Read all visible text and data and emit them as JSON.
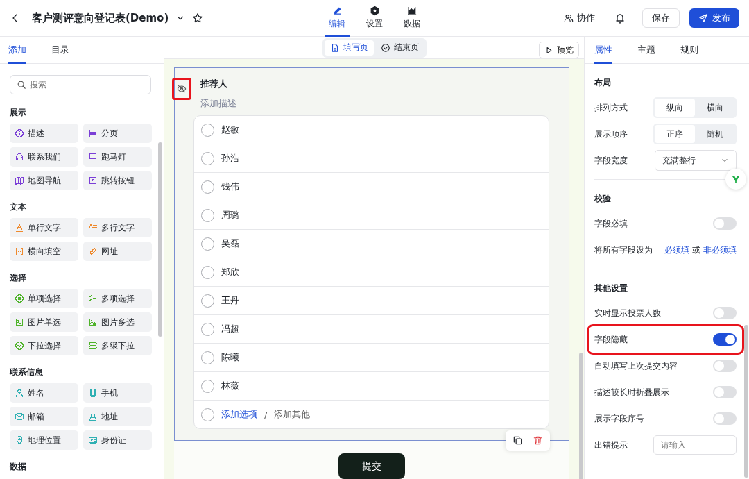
{
  "header": {
    "title": "客户测评意向登记表(Demo)",
    "nav": [
      {
        "label": "编辑",
        "selected": true
      },
      {
        "label": "设置",
        "selected": false
      },
      {
        "label": "数据",
        "selected": false
      }
    ],
    "collab": "协作",
    "save": "保存",
    "publish": "发布"
  },
  "left": {
    "tabs": [
      {
        "label": "添加",
        "selected": true
      },
      {
        "label": "目录",
        "selected": false
      }
    ],
    "search": {
      "placeholder": "搜索"
    },
    "groups": [
      {
        "title": "展示",
        "color": "#7b3fd6",
        "items": [
          "描述",
          "分页",
          "联系我们",
          "跑马灯",
          "地图导航",
          "跳转按钮"
        ]
      },
      {
        "title": "文本",
        "color": "#ef8a2d",
        "items": [
          "单行文字",
          "多行文字",
          "横向填空",
          "网址"
        ]
      },
      {
        "title": "选择",
        "color": "#4fb32a",
        "items": [
          "单项选择",
          "多项选择",
          "图片单选",
          "图片多选",
          "下拉选择",
          "多级下拉"
        ]
      },
      {
        "title": "联系信息",
        "color": "#2fb0b3",
        "items": [
          "姓名",
          "手机",
          "邮箱",
          "地址",
          "地理位置",
          "身份证"
        ]
      },
      {
        "title": "数据"
      }
    ]
  },
  "center": {
    "pages": [
      {
        "label": "填写页",
        "selected": true
      },
      {
        "label": "结束页",
        "selected": false
      }
    ],
    "preview": "预览",
    "question": {
      "title": "推荐人",
      "hidden": true,
      "description": "添加描述",
      "options": [
        {
          "label": "赵敏",
          "checked": false
        },
        {
          "label": "孙浩",
          "checked": false
        },
        {
          "label": "钱伟",
          "checked": false
        },
        {
          "label": "周璐",
          "checked": false
        },
        {
          "label": "吴磊",
          "checked": false
        },
        {
          "label": "郑欣",
          "checked": false
        },
        {
          "label": "王丹",
          "checked": false
        },
        {
          "label": "冯超",
          "checked": false
        },
        {
          "label": "陈曦",
          "checked": false
        },
        {
          "label": "林薇",
          "checked": false
        }
      ],
      "add_option": "添加选项",
      "separator": "/",
      "add_other": "添加其他"
    },
    "submit": "提交"
  },
  "right": {
    "tabs": [
      {
        "label": "属性",
        "selected": true
      },
      {
        "label": "主题",
        "selected": false
      },
      {
        "label": "规则",
        "selected": false
      }
    ],
    "layout": {
      "title": "布局",
      "rows": [
        {
          "kind": "segmented",
          "label": "排列方式",
          "options": [
            {
              "label": "纵向",
              "selected": true
            },
            {
              "label": "横向",
              "selected": false
            }
          ]
        },
        {
          "kind": "segmented",
          "label": "展示顺序",
          "options": [
            {
              "label": "正序",
              "selected": true
            },
            {
              "label": "随机",
              "selected": false
            }
          ]
        },
        {
          "kind": "select",
          "label": "字段宽度",
          "value": "充满整行"
        }
      ]
    },
    "validation": {
      "title": "校验",
      "required_label": "字段必填",
      "required": false,
      "all_label": "将所有字段设为",
      "must": "必须填",
      "or": "或",
      "optional": "非必须填"
    },
    "other": {
      "title": "其他设置",
      "toggles": [
        {
          "label": "实时显示投票人数",
          "on": false,
          "highlighted": false
        },
        {
          "label": "字段隐藏",
          "on": true,
          "highlighted": true
        },
        {
          "label": "自动填写上次提交内容",
          "on": false,
          "highlighted": false
        },
        {
          "label": "描述较长时折叠展示",
          "on": false,
          "highlighted": false
        },
        {
          "label": "展示字段序号",
          "on": false,
          "highlighted": false
        }
      ],
      "error_label": "出错提示",
      "error_placeholder": "请输入"
    }
  }
}
